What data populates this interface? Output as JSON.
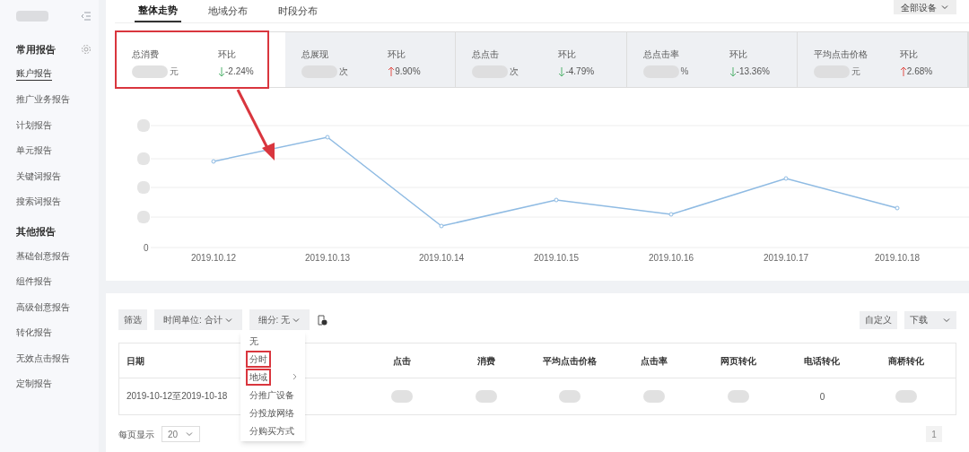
{
  "sidebar": {
    "sections": [
      {
        "title": "常用报告",
        "settings": true,
        "items": [
          {
            "label": "账户报告",
            "selected": true
          },
          {
            "label": "推广业务报告",
            "selected": false
          },
          {
            "label": "计划报告",
            "selected": false
          },
          {
            "label": "单元报告",
            "selected": false
          },
          {
            "label": "关键词报告",
            "selected": false
          },
          {
            "label": "搜索词报告",
            "selected": false
          }
        ]
      },
      {
        "title": "其他报告",
        "settings": false,
        "items": [
          {
            "label": "基础创意报告",
            "selected": false
          },
          {
            "label": "组件报告",
            "selected": false
          },
          {
            "label": "高级创意报告",
            "selected": false
          },
          {
            "label": "转化报告",
            "selected": false
          },
          {
            "label": "无效点击报告",
            "selected": false
          },
          {
            "label": "定制报告",
            "selected": false
          }
        ]
      }
    ]
  },
  "tabs": [
    {
      "label": "整体走势",
      "selected": true
    },
    {
      "label": "地域分布",
      "selected": false
    },
    {
      "label": "时段分布",
      "selected": false
    }
  ],
  "device_select": {
    "value": "全部设备"
  },
  "metrics": [
    {
      "label": "总消费",
      "unit": "元",
      "change_label": "环比",
      "change": "-2.24%",
      "rising": false,
      "selected": true
    },
    {
      "label": "总展现",
      "unit": "次",
      "change_label": "环比",
      "change": "9.90%",
      "rising": true,
      "selected": false
    },
    {
      "label": "总点击",
      "unit": "次",
      "change_label": "环比",
      "change": "-4.79%",
      "rising": false,
      "selected": false
    },
    {
      "label": "总点击率",
      "unit": "%",
      "change_label": "环比",
      "change": "-13.36%",
      "rising": false,
      "selected": false
    },
    {
      "label": "平均点击价格",
      "unit": "元",
      "change_label": "环比",
      "change": "2.68%",
      "rising": true,
      "selected": false
    }
  ],
  "chart": {
    "y_zero_label": "0",
    "x_labels": [
      "2019.10.12",
      "2019.10.13",
      "2019.10.14",
      "2019.10.15",
      "2019.10.16",
      "2019.10.17",
      "2019.10.18"
    ]
  },
  "toolbar": {
    "filter": "筛选",
    "time_unit": "时间单位: 合计",
    "breakdown": "细分: 无",
    "customize": "自定义",
    "download": "下载"
  },
  "breakdown_menu": [
    {
      "label": "无",
      "highlighted": false,
      "submenu": false
    },
    {
      "label": "分时",
      "highlighted": true,
      "submenu": false
    },
    {
      "label": "地域",
      "highlighted": true,
      "submenu": true
    },
    {
      "label": "分推广设备",
      "highlighted": false,
      "submenu": false
    },
    {
      "label": "分投放网络",
      "highlighted": false,
      "submenu": false
    },
    {
      "label": "分购买方式",
      "highlighted": false,
      "submenu": false
    }
  ],
  "table": {
    "columns": [
      "日期",
      "点击",
      "消费",
      "平均点击价格",
      "点击率",
      "网页转化",
      "电话转化",
      "商桥转化"
    ],
    "rows": [
      {
        "cells": [
          {
            "kind": "text",
            "text": "2019-10-12至2019-10-18"
          },
          {
            "kind": "blurred"
          },
          {
            "kind": "blurred"
          },
          {
            "kind": "blurred"
          },
          {
            "kind": "blurred"
          },
          {
            "kind": "blurred"
          },
          {
            "kind": "text",
            "text": "0"
          },
          {
            "kind": "blurred"
          }
        ]
      }
    ]
  },
  "pagination": {
    "page_size_label": "每页显示",
    "page_size": "20",
    "page": "1"
  }
}
